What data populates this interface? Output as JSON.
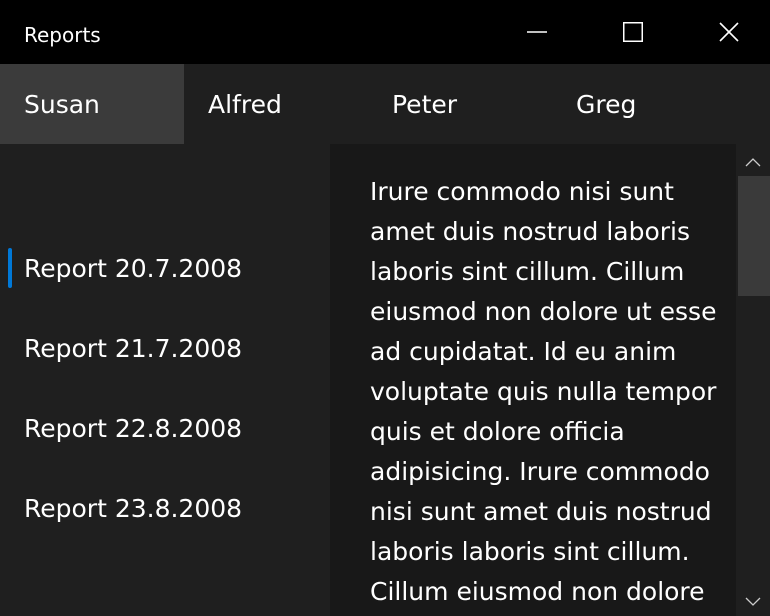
{
  "window": {
    "title": "Reports"
  },
  "caption_buttons": {
    "minimize_icon": "minimize-icon",
    "maximize_icon": "maximize-icon",
    "close_icon": "close-icon"
  },
  "tabs": [
    {
      "label": "Susan",
      "selected": true
    },
    {
      "label": "Alfred",
      "selected": false
    },
    {
      "label": "Peter",
      "selected": false
    },
    {
      "label": "Greg",
      "selected": false
    }
  ],
  "reports": [
    {
      "label": "Report 20.7.2008",
      "selected": true
    },
    {
      "label": "Report 21.7.2008",
      "selected": false
    },
    {
      "label": "Report 22.8.2008",
      "selected": false
    },
    {
      "label": "Report 23.8.2008",
      "selected": false
    }
  ],
  "content": {
    "text": "Irure commodo nisi sunt amet duis nostrud laboris laboris sint cillum. Cillum eiusmod non dolore ut esse ad cupidatat. Id eu anim voluptate quis nulla tempor quis et dolore officia adipisicing. Irure commodo nisi sunt amet duis nostrud laboris laboris sint cillum. Cillum eiusmod non dolore"
  },
  "colors": {
    "accent": "#0078d7",
    "titlebar_bg": "#000000",
    "selected_tab_bg": "#3b3b3b",
    "pane_bg": "#1f1f1f",
    "content_bg": "#181818"
  }
}
